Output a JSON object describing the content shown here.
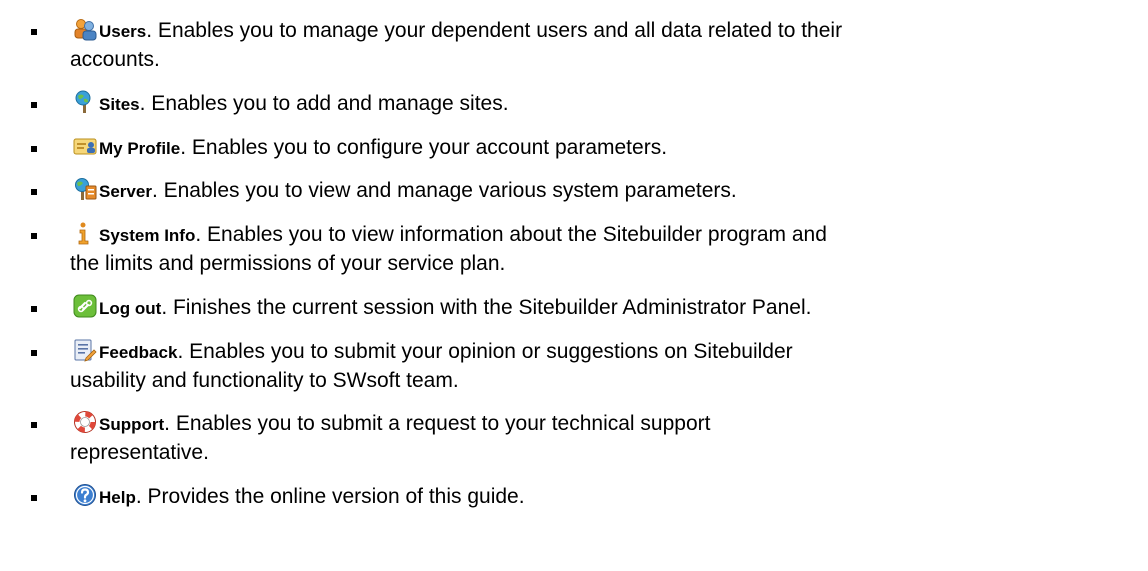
{
  "items": [
    {
      "icon": "users-icon",
      "name": "Users",
      "line1": ". Enables you to manage your dependent users and all data related to their",
      "line2": "accounts."
    },
    {
      "icon": "sites-icon",
      "name": "Sites",
      "line1": ". Enables you to add and manage sites.",
      "line2": ""
    },
    {
      "icon": "my-profile-icon",
      "name": "My Profile",
      "line1": ". Enables you to configure your account parameters.",
      "line2": ""
    },
    {
      "icon": "server-icon",
      "name": "Server",
      "line1": ". Enables you to view and manage various system parameters.",
      "line2": ""
    },
    {
      "icon": "system-info-icon",
      "name": "System Info",
      "line1": ". Enables you to view information about the Sitebuilder program and",
      "line2": "the limits and permissions of your service plan."
    },
    {
      "icon": "log-out-icon",
      "name": "Log out",
      "line1": ". Finishes the current session with the Sitebuilder Administrator Panel.",
      "line2": ""
    },
    {
      "icon": "feedback-icon",
      "name": "Feedback",
      "line1": ". Enables you to submit your opinion or suggestions on Sitebuilder",
      "line2": "usability and functionality to SWsoft team."
    },
    {
      "icon": "support-icon",
      "name": "Support",
      "line1": ". Enables you to submit a request to your technical support",
      "line2": "representative."
    },
    {
      "icon": "help-icon",
      "name": "Help",
      "line1": ". Provides the online version of this guide.",
      "line2": ""
    }
  ]
}
